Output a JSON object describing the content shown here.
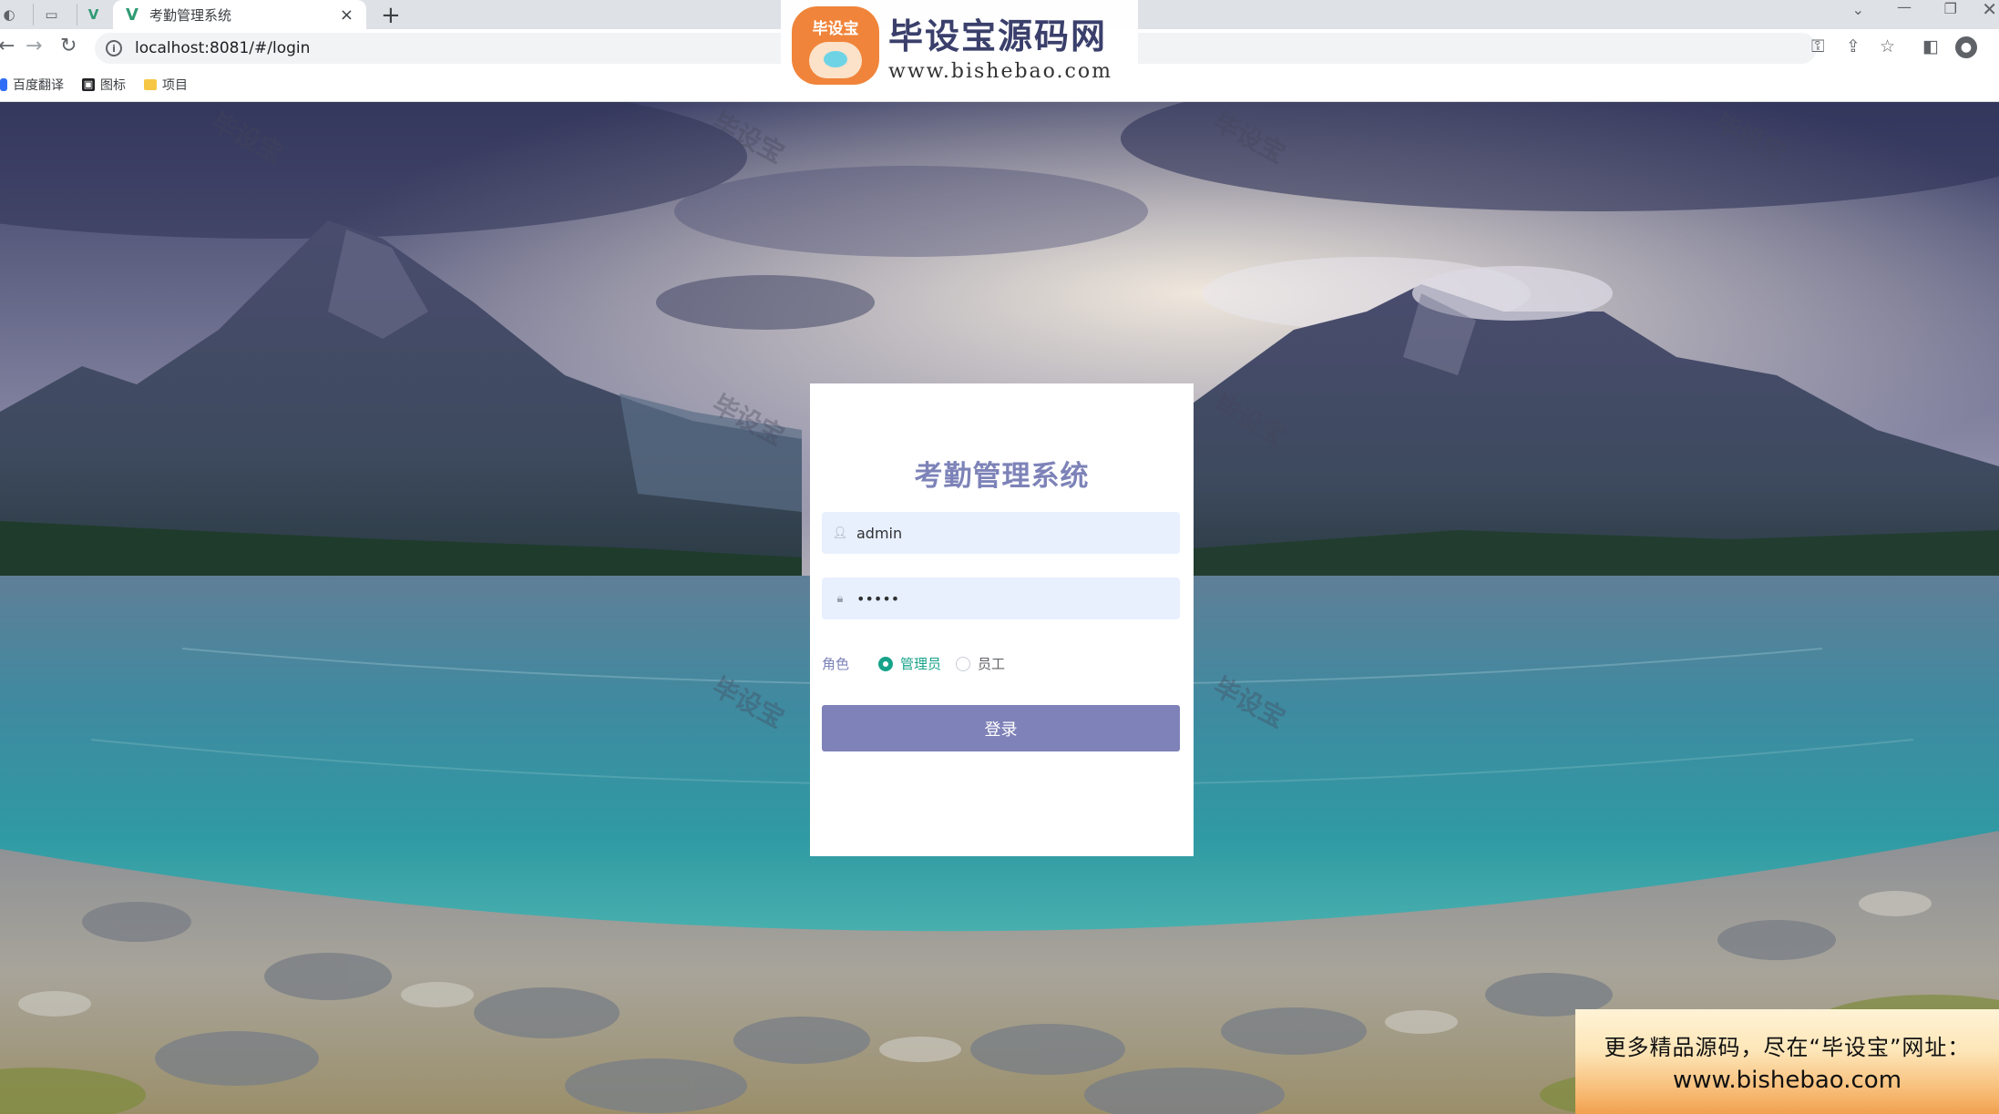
{
  "browser": {
    "tab_title": "考勤管理系统",
    "tab_close": "×",
    "new_tab": "+",
    "url": "localhost:8081/#/login",
    "bookmarks": [
      {
        "label": "百度翻译",
        "icon": "translate-icon"
      },
      {
        "label": "图标",
        "icon": "image-icon"
      },
      {
        "label": "项目",
        "icon": "folder-icon"
      }
    ]
  },
  "banner": {
    "logo_text": "毕设宝",
    "title": "毕设宝源码网",
    "url": "www.bishebao.com"
  },
  "login": {
    "title": "考勤管理系统",
    "username_value": "admin",
    "password_value": "*****",
    "role_label": "角色",
    "roles": [
      "管理员",
      "员工"
    ],
    "selected_role": "管理员",
    "submit_label": "登录",
    "accent_color": "#17a38a",
    "button_color": "#7f82b8"
  },
  "watermark": {
    "text": "毕设宝"
  },
  "promo": {
    "line1": "更多精品源码，尽在“毕设宝”网址：",
    "line2": "www.bishebao.com"
  }
}
